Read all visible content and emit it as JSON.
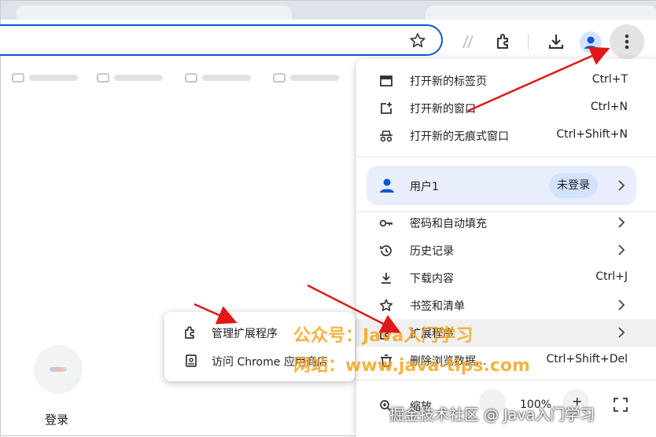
{
  "toolbar": {
    "bookmark_star": "star-icon",
    "icons": [
      "app-icon",
      "extensions-icon",
      "downloads-icon",
      "profile-icon",
      "more-vert-icon"
    ]
  },
  "page": {
    "login_label": "登录"
  },
  "menu": {
    "new_tab": {
      "label": "打开新的标签页",
      "shortcut": "Ctrl+T"
    },
    "new_window": {
      "label": "打开新的窗口",
      "shortcut": "Ctrl+N"
    },
    "incognito": {
      "label": "打开新的无痕式窗口",
      "shortcut": "Ctrl+Shift+N"
    },
    "profile": {
      "name": "用户1",
      "status": "未登录"
    },
    "passwords": {
      "label": "密码和自动填充"
    },
    "history": {
      "label": "历史记录"
    },
    "downloads": {
      "label": "下载内容",
      "shortcut": "Ctrl+J"
    },
    "bookmarks": {
      "label": "书签和清单"
    },
    "extensions": {
      "label": "扩展程序"
    },
    "clear_data": {
      "label": "删除浏览数据...",
      "shortcut": "Ctrl+Shift+Del"
    },
    "zoom": {
      "label": "缩放",
      "value": "100%",
      "plus": "+"
    }
  },
  "submenu": {
    "manage": "管理扩展程序",
    "webstore": "访问 Chrome 应用商店"
  },
  "watermarks": {
    "line1": "公众号：Java入门学习",
    "line2": "网站：www.java-tips.com",
    "footer": "掘金技术社区 @ Java入门学习"
  },
  "colors": {
    "accent": "#0b57d0",
    "arrow": "#e01818",
    "watermark": "#f5a623"
  }
}
